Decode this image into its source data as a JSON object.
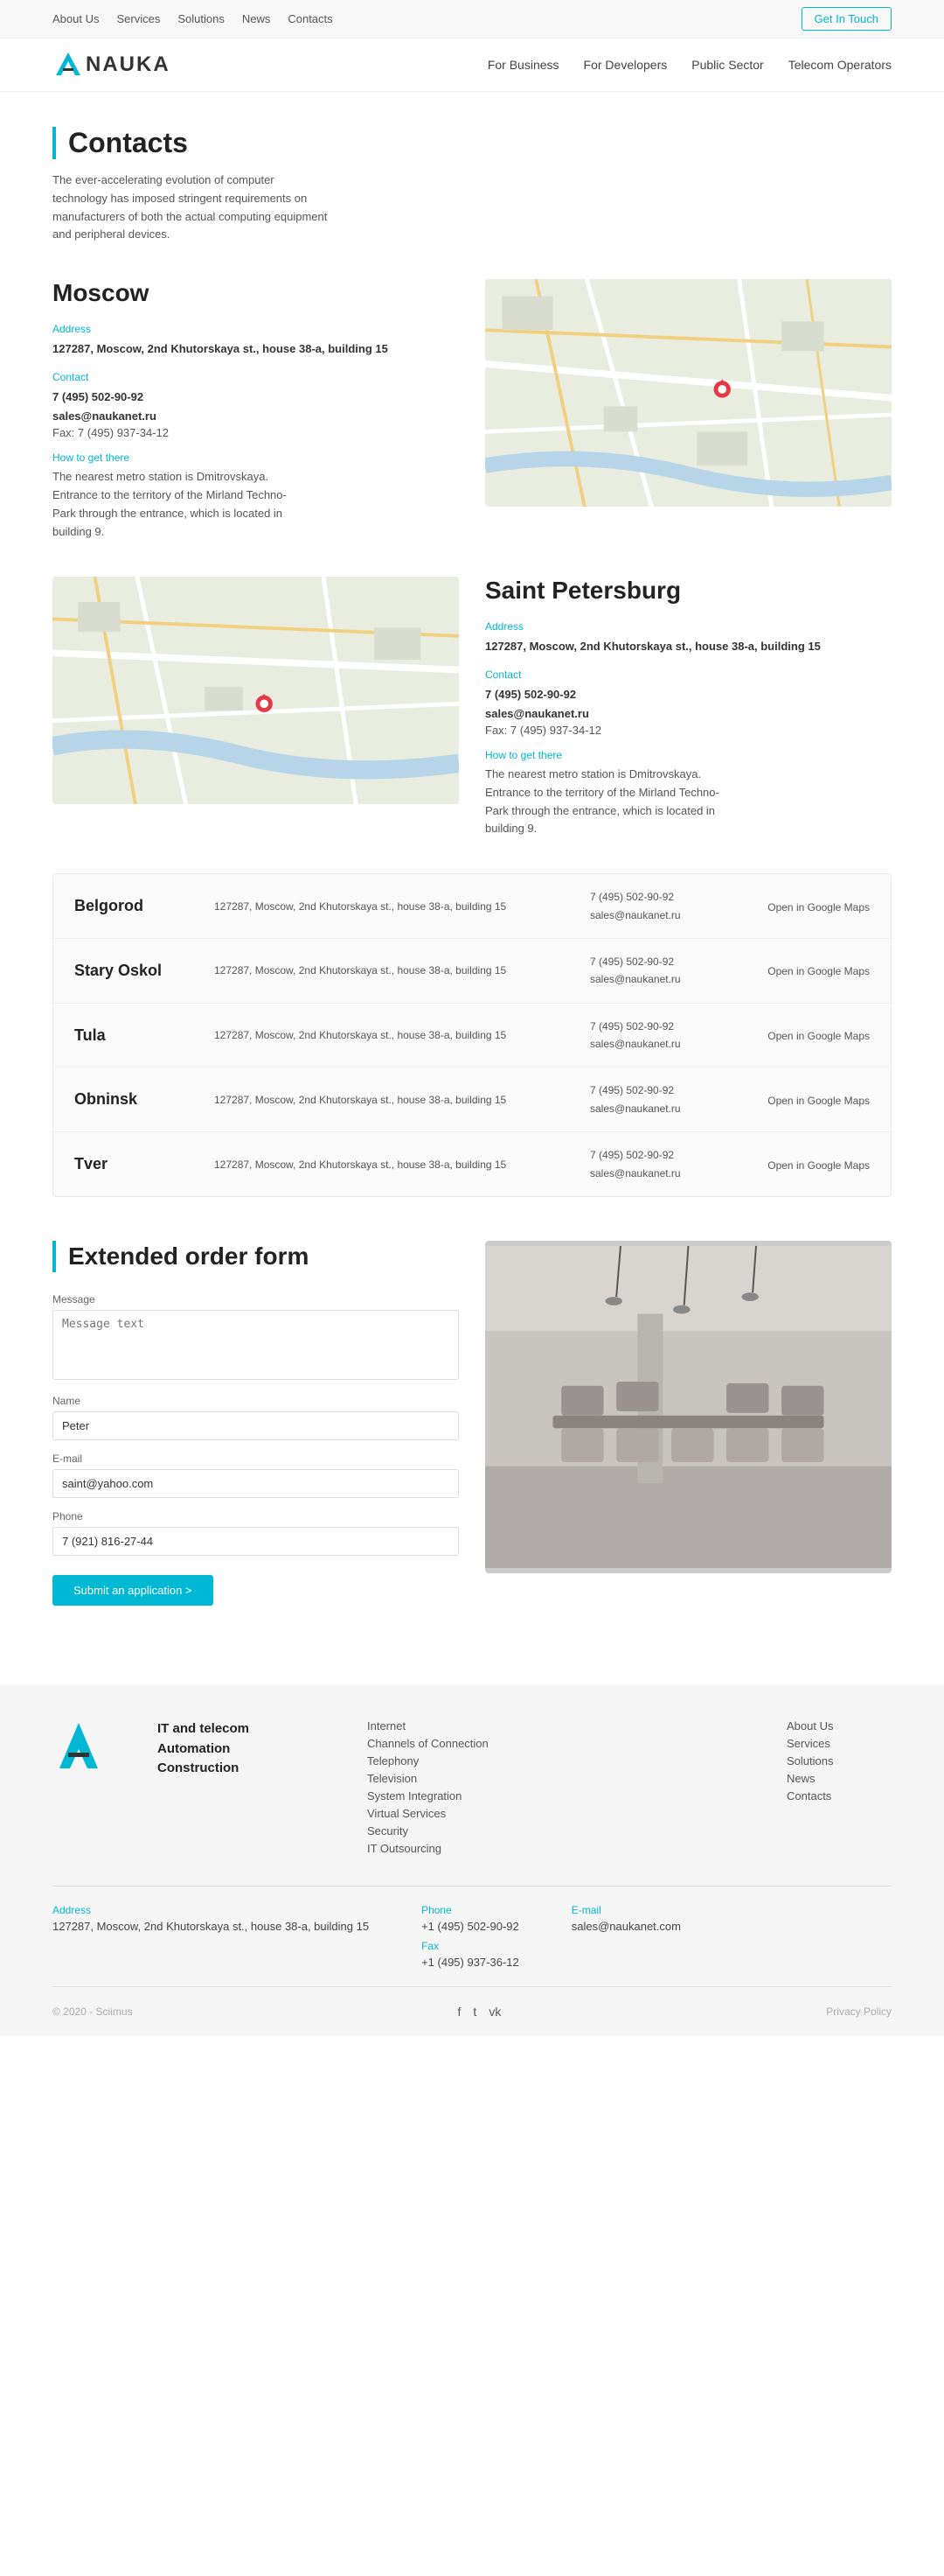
{
  "topbar": {
    "links": [
      "About Us",
      "Services",
      "Solutions",
      "News",
      "Contacts"
    ],
    "cta": "Get In Touch"
  },
  "nav": {
    "logo": "NAUKA",
    "links": [
      "For Business",
      "For Developers",
      "Public Sector",
      "Telecom Operators"
    ]
  },
  "contacts": {
    "title": "Contacts",
    "description": "The ever-accelerating evolution of computer technology has imposed stringent requirements on manufacturers of both the actual computing equipment and peripheral devices."
  },
  "moscow": {
    "city": "Moscow",
    "address_label": "Address",
    "address": "127287, Moscow, 2nd Khutorskaya st., house 38-a, building 15",
    "contact_label": "Contact",
    "phone": "7 (495) 502-90-92",
    "email": "sales@naukanet.ru",
    "fax": "Fax: 7 (495) 937-34-12",
    "how_label": "How to get there",
    "how_text": "The nearest metro station is Dmitrovskaya. Entrance to the territory of the Mirland Techno-Park through the entrance, which is located in building 9."
  },
  "saint_petersburg": {
    "city": "Saint Petersburg",
    "address_label": "Address",
    "address": "127287, Moscow, 2nd Khutorskaya st., house 38-a, building 15",
    "contact_label": "Contact",
    "phone": "7 (495) 502-90-92",
    "email": "sales@naukanet.ru",
    "fax": "Fax: 7 (495) 937-34-12",
    "how_label": "How to get there",
    "how_text": "The nearest metro station is Dmitrovskaya. Entrance to the territory of the Mirland Techno-Park through the entrance, which is located in building 9."
  },
  "other_cities": [
    {
      "name": "Belgorod",
      "address": "127287, Moscow, 2nd Khutorskaya st., house 38-a, building 15",
      "phone": "7 (495) 502-90-92",
      "email": "sales@naukanet.ru",
      "map_link": "Open in Google Maps"
    },
    {
      "name": "Stary Oskol",
      "address": "127287, Moscow, 2nd Khutorskaya st., house 38-a, building 15",
      "phone": "7 (495) 502-90-92",
      "email": "sales@naukanet.ru",
      "map_link": "Open in Google Maps"
    },
    {
      "name": "Tula",
      "address": "127287, Moscow, 2nd Khutorskaya st., house 38-a, building 15",
      "phone": "7 (495) 502-90-92",
      "email": "sales@naukanet.ru",
      "map_link": "Open in Google Maps"
    },
    {
      "name": "Obninsk",
      "address": "127287, Moscow, 2nd Khutorskaya st., house 38-a, building 15",
      "phone": "7 (495) 502-90-92",
      "email": "sales@naukanet.ru",
      "map_link": "Open in Google Maps"
    },
    {
      "name": "Tver",
      "address": "127287, Moscow, 2nd Khutorskaya st., house 38-a, building 15",
      "phone": "7 (495) 502-90-92",
      "email": "sales@naukanet.ru",
      "map_link": "Open in Google Maps"
    }
  ],
  "form": {
    "title": "Extended order form",
    "message_label": "Message",
    "message_placeholder": "Message text",
    "name_label": "Name",
    "name_value": "Peter",
    "email_label": "E-mail",
    "email_value": "saint@yahoo.com",
    "phone_label": "Phone",
    "phone_value": "7 (921) 816-27-44",
    "submit": "Submit an application >"
  },
  "footer": {
    "brand_lines": [
      "IT and telecom",
      "Automation",
      "Construction"
    ],
    "links_col1": [
      "Internet",
      "Channels of Connection",
      "Telephony",
      "Television",
      "System Integration",
      "Virtual Services",
      "Security",
      "IT Outsourcing"
    ],
    "links_col2": [
      "About Us",
      "Services",
      "Solutions",
      "News",
      "Contacts"
    ],
    "address_label": "Address",
    "address_value": "127287, Moscow, 2nd Khutorskaya st., house 38-a, building 15",
    "phone_label": "Phone",
    "phone_value": "+1 (495) 502-90-92",
    "fax_label": "Fax",
    "fax_value": "+1 (495) 937-36-12",
    "email_label": "E-mail",
    "email_value": "sales@naukanet.com",
    "copyright": "© 2020 - Sciimus",
    "privacy": "Privacy Policy",
    "social": [
      "f",
      "t",
      "vk"
    ]
  }
}
